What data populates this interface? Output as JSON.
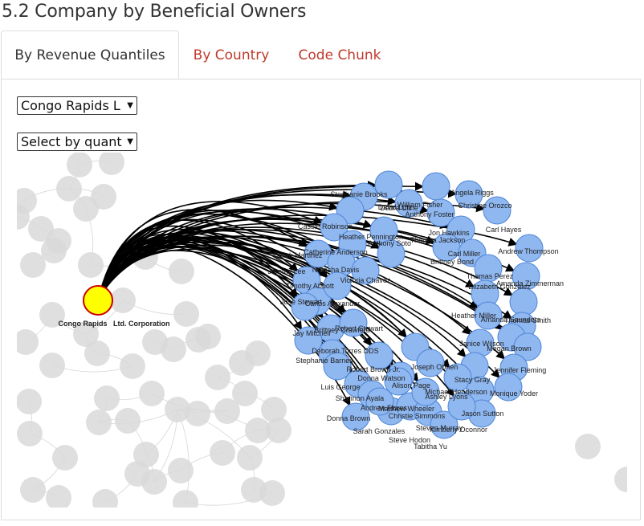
{
  "page": {
    "title": "5.2 Company by Beneficial Owners"
  },
  "tabs": [
    {
      "label": "By Revenue Quantiles",
      "active": true
    },
    {
      "label": "By Country",
      "active": false
    },
    {
      "label": "Code Chunk",
      "active": false
    }
  ],
  "controls": {
    "company_select": {
      "value": "Congo Rapids L"
    },
    "quantile_select": {
      "value": "Select by quant"
    }
  },
  "colors": {
    "link": "#c0392b",
    "company_node": "#ffff00",
    "company_stroke": "#cc0000",
    "owner_node": "#8fb7f0"
  },
  "network": {
    "company": {
      "label": "Congo Rapids   Ltd. Corporation"
    },
    "owners": [
      "Debra Cline",
      "William Fisher",
      "Stephanie Brooks",
      "Angela Riggs",
      "David Lutz",
      "Christine Orozco",
      "Cassie Robinson",
      "Anthony Foster",
      "Carl Hayes",
      "Heather Pennington",
      "Jon Hawkins",
      "Catherine Anderson",
      "Anthony Soto",
      "Derek Martinez",
      "Theresa Jackson",
      "Carl Miller",
      "Andrew Thompson",
      "Brittney Bond",
      "Jeremy Lee",
      "Natasha Davis",
      "Victoria Chavez",
      "Timothy Abbott",
      "Thomas Perez",
      "Amanda Zimmerman",
      "Elizabeth Gonzalez",
      "Jose Stewart",
      "Carlos Alexander",
      "Brittney Crawford",
      "Heather Miller",
      "Thomas Smith",
      "Amanda Saunders",
      "Jay Mitchell",
      "Robert Stewart",
      "Janice Wilson",
      "Megan Brown",
      "Deborah Torres DDS",
      "Stephanie Barnes",
      "Joseph Obrien",
      "Robert Brown Jr.",
      "Jennifer Fleming",
      "Donna Watson",
      "Alison Page",
      "Stacy Gray",
      "Luis George",
      "Michael Henderson",
      "Monique Yoder",
      "Shannon Ayala",
      "Ashley Lyons",
      "Andrew Flores",
      "Matthew Wheeler",
      "Jason Sutton",
      "Christie Simmons",
      "Donna Brown",
      "Steven Murray",
      "Kimberly Oconnor",
      "Sarah Gonzales",
      "Steve Hodon",
      "Tabitha Yu"
    ]
  }
}
